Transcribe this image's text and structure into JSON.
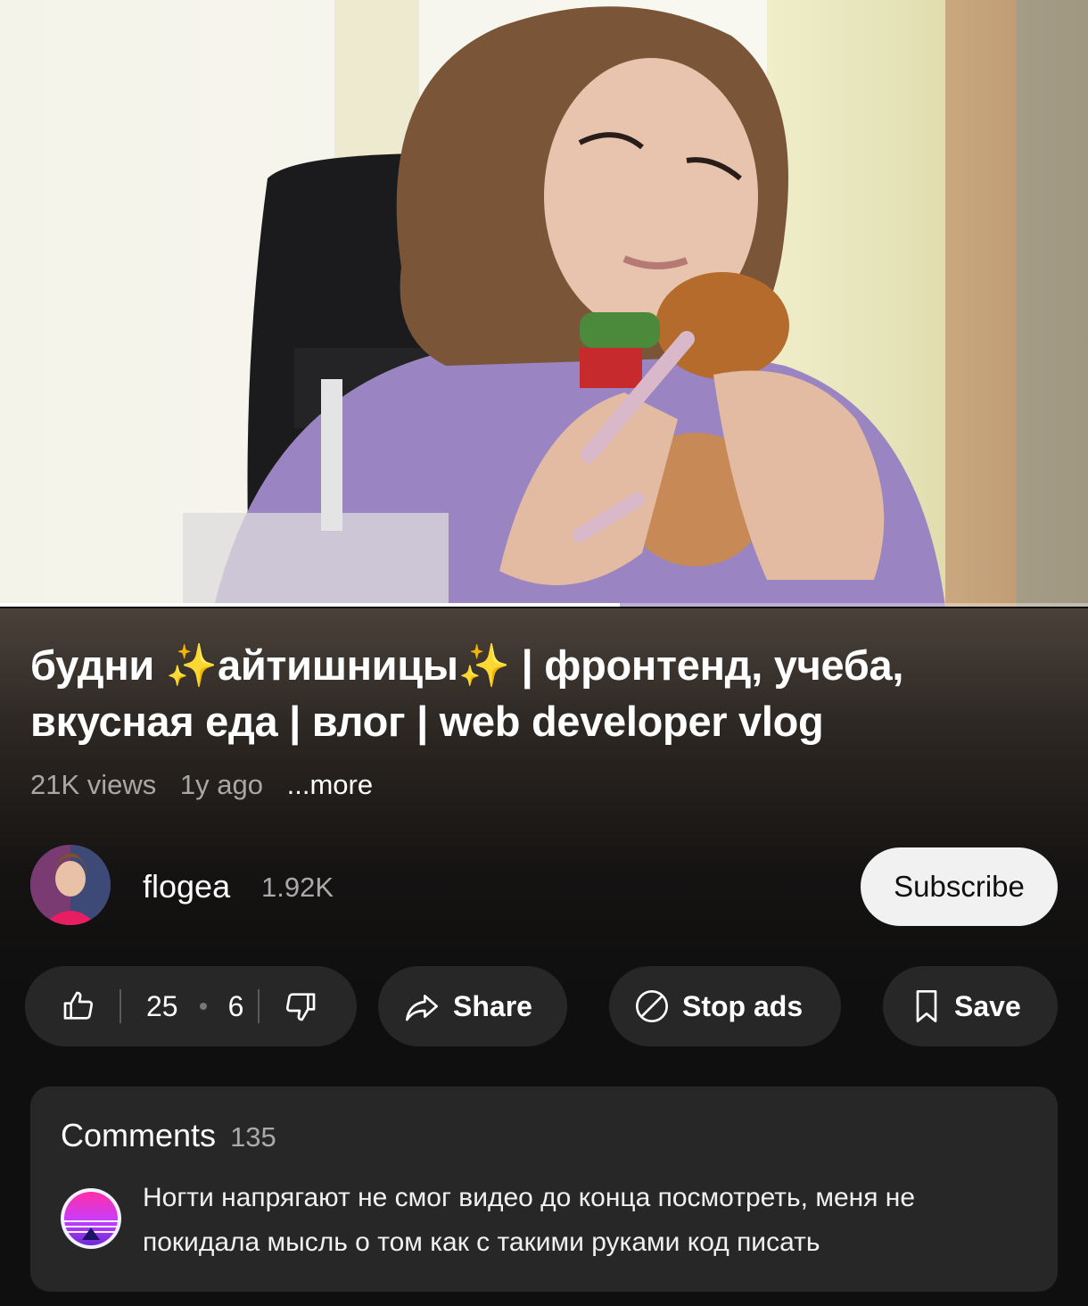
{
  "player": {
    "progress_fraction": 0.57
  },
  "video": {
    "title": "будни ✨айтишницы✨ | фронтенд, учеба, вкусная еда | влог | web developer vlog",
    "views": "21K views",
    "age": "1y ago",
    "more_label": "...more"
  },
  "channel": {
    "name": "flogea",
    "subscribers": "1.92K",
    "subscribe_label": "Subscribe"
  },
  "actions": {
    "likes": "25",
    "dislikes": "6",
    "share_label": "Share",
    "stop_ads_label": "Stop ads",
    "save_label": "Save"
  },
  "comments": {
    "heading": "Comments",
    "count": "135",
    "top_comment": "Ногти напрягают не смог видео до конца посмотреть, меня не покидала мысль о том как с такими руками код писать"
  },
  "icons": [
    "like-icon",
    "dislike-icon",
    "share-icon",
    "stop-ads-icon",
    "save-icon"
  ],
  "colors": {
    "background": "#0f0f0f",
    "pill": "#272727",
    "subscribe_bg": "#f1f1f1"
  }
}
